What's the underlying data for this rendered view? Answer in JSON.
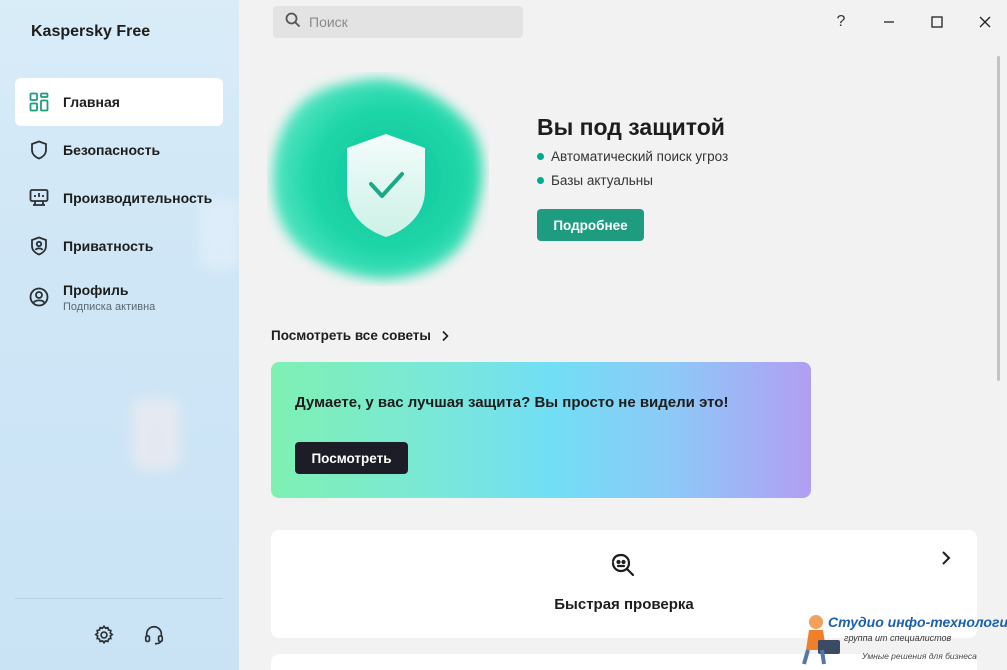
{
  "app": {
    "title": "Kaspersky Free"
  },
  "sidebar": {
    "items": [
      {
        "label": "Главная",
        "icon": "dashboard-icon",
        "active": true
      },
      {
        "label": "Безопасность",
        "icon": "shield-icon"
      },
      {
        "label": "Производительность",
        "icon": "performance-icon"
      },
      {
        "label": "Приватность",
        "icon": "privacy-icon"
      },
      {
        "label": "Профиль",
        "sublabel": "Подписка активна",
        "icon": "user-icon"
      }
    ],
    "footer": {
      "settings_icon": "gear-icon",
      "support_icon": "headset-icon"
    }
  },
  "search": {
    "placeholder": "Поиск"
  },
  "window_controls": {
    "help": "?",
    "minimize": "minimize-icon",
    "maximize": "maximize-icon",
    "close": "close-icon"
  },
  "status": {
    "title": "Вы под защитой",
    "lines": [
      "Автоматический поиск угроз",
      "Базы актуальны"
    ],
    "button": "Подробнее"
  },
  "tips": {
    "link": "Посмотреть все советы"
  },
  "promo": {
    "text": "Думаете, у вас лучшая защита? Вы просто не видели это!",
    "button": "Посмотреть"
  },
  "quick_scan": {
    "label": "Быстрая проверка"
  },
  "colors": {
    "accent": "#1e9c80",
    "status_dot": "#00a88e",
    "sidebar_bg": "#cfe6f6",
    "promo_dark_button": "#1d1d27"
  },
  "watermark": {
    "title": "Студио инфо-технологии",
    "subtitle": "группа ит специалистов",
    "tagline": "Умные решения для бизнеса"
  }
}
